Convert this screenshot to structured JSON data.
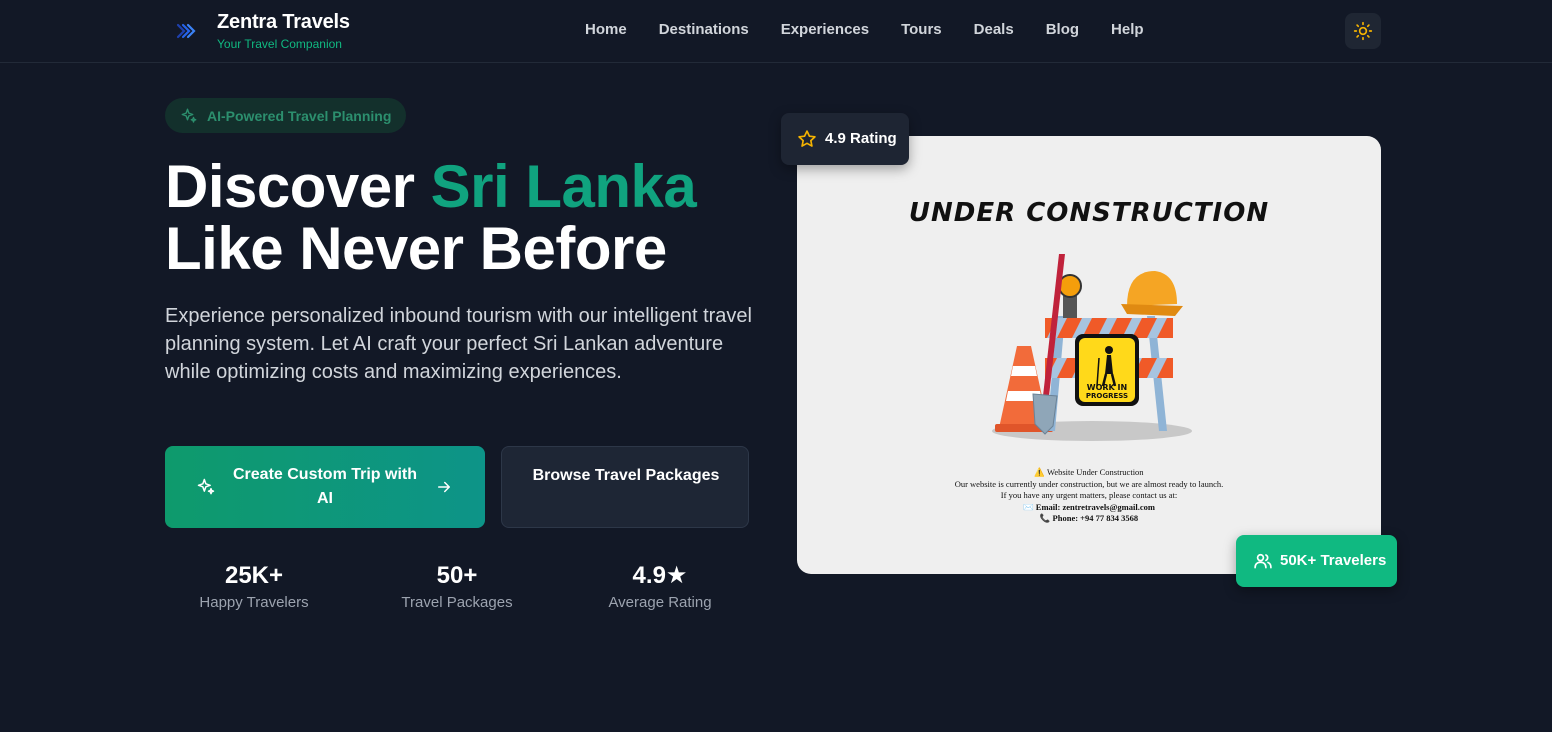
{
  "header": {
    "brand": "Zentra Travels",
    "tagline": "Your Travel Companion",
    "nav": [
      "Home",
      "Destinations",
      "Experiences",
      "Tours",
      "Deals",
      "Blog",
      "Help"
    ],
    "theme_toggle_icon": "sun-icon"
  },
  "hero": {
    "badge": "AI-Powered Travel Planning",
    "title_part1": "Discover ",
    "title_accent": "Sri Lanka",
    "title_line2": "Like Never Before",
    "description": "Experience personalized inbound tourism with our intelligent travel planning system. Let AI craft your perfect Sri Lankan adventure while optimizing costs and maximizing experiences.",
    "primary_button": "Create Custom Trip with AI",
    "secondary_button": "Browse Travel Packages",
    "stats": [
      {
        "value": "25K+",
        "label": "Happy Travelers"
      },
      {
        "value": "50+",
        "label": "Travel Packages"
      },
      {
        "value": "4.9★",
        "label": "Average Rating"
      }
    ]
  },
  "showcase": {
    "rating_badge": "4.9 Rating",
    "travelers_badge": "50K+ Travelers",
    "image": {
      "title": "UNDER CONSTRUCTION",
      "sign_text": "WORK IN PROGRESS",
      "line1": "⚠️ Website Under Construction",
      "line2": "Our website is currently under construction, but we are almost ready to launch.",
      "line3": "If you have any urgent matters, please contact us at:",
      "line4": "✉️ Email: zentretravels@gmail.com",
      "line5": "📞 Phone: +94 77 834 3568"
    }
  },
  "colors": {
    "background": "#121826",
    "accent": "#10b981",
    "accent_dark": "#0e9a6c",
    "card": "#1e2533"
  }
}
